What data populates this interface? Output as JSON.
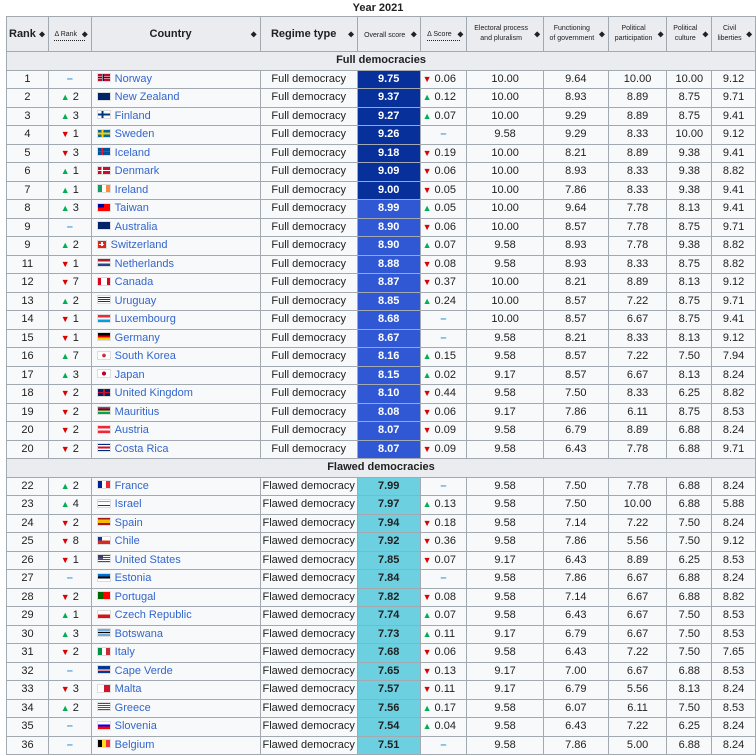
{
  "caption": "Year 2021",
  "headers": {
    "rank": "Rank",
    "delta_rank": "Δ Rank",
    "country": "Country",
    "regime_type": "Regime type",
    "overall_score": "Overall score",
    "delta_score": "Δ Score",
    "electoral": [
      "Electoral process",
      "and pluralism"
    ],
    "functioning": [
      "Functioning",
      "of government"
    ],
    "participation": [
      "Political",
      "participation"
    ],
    "culture": [
      "Political",
      "culture"
    ],
    "liberties": [
      "Civil",
      "liberties"
    ],
    "sort_icon": "⬥"
  },
  "colors": {
    "score_dark": "#08309a",
    "score_mid": "#3058d4",
    "score_flawed": "#6dd0e0",
    "up": "#00b050",
    "down": "#dd0000",
    "no_change": "#3b9cdd"
  },
  "sections": [
    {
      "title": "Full democracies",
      "rows": [
        {
          "rank": "1",
          "dr_dir": "none",
          "dr": "",
          "country": "Norway",
          "flag": "norway",
          "regime": "Full democracy",
          "score": "9.75",
          "tier": "dark",
          "ds_dir": "down",
          "ds": "0.06",
          "ep": "10.00",
          "fg": "9.64",
          "pp": "10.00",
          "pc": "10.00",
          "cl": "9.12"
        },
        {
          "rank": "2",
          "dr_dir": "up",
          "dr": "2",
          "country": "New Zealand",
          "flag": "nz",
          "regime": "Full democracy",
          "score": "9.37",
          "tier": "dark",
          "ds_dir": "up",
          "ds": "0.12",
          "ep": "10.00",
          "fg": "8.93",
          "pp": "8.89",
          "pc": "8.75",
          "cl": "9.71"
        },
        {
          "rank": "3",
          "dr_dir": "up",
          "dr": "3",
          "country": "Finland",
          "flag": "finland",
          "regime": "Full democracy",
          "score": "9.27",
          "tier": "dark",
          "ds_dir": "up",
          "ds": "0.07",
          "ep": "10.00",
          "fg": "9.29",
          "pp": "8.89",
          "pc": "8.75",
          "cl": "9.41"
        },
        {
          "rank": "4",
          "dr_dir": "down",
          "dr": "1",
          "country": "Sweden",
          "flag": "sweden",
          "regime": "Full democracy",
          "score": "9.26",
          "tier": "dark",
          "ds_dir": "none",
          "ds": "",
          "ep": "9.58",
          "fg": "9.29",
          "pp": "8.33",
          "pc": "10.00",
          "cl": "9.12"
        },
        {
          "rank": "5",
          "dr_dir": "down",
          "dr": "3",
          "country": "Iceland",
          "flag": "iceland",
          "regime": "Full democracy",
          "score": "9.18",
          "tier": "dark",
          "ds_dir": "down",
          "ds": "0.19",
          "ep": "10.00",
          "fg": "8.21",
          "pp": "8.89",
          "pc": "9.38",
          "cl": "9.41"
        },
        {
          "rank": "6",
          "dr_dir": "up",
          "dr": "1",
          "country": "Denmark",
          "flag": "denmark",
          "regime": "Full democracy",
          "score": "9.09",
          "tier": "dark",
          "ds_dir": "down",
          "ds": "0.06",
          "ep": "10.00",
          "fg": "8.93",
          "pp": "8.33",
          "pc": "9.38",
          "cl": "8.82"
        },
        {
          "rank": "7",
          "dr_dir": "up",
          "dr": "1",
          "country": "Ireland",
          "flag": "ireland",
          "regime": "Full democracy",
          "score": "9.00",
          "tier": "dark",
          "ds_dir": "down",
          "ds": "0.05",
          "ep": "10.00",
          "fg": "7.86",
          "pp": "8.33",
          "pc": "9.38",
          "cl": "9.41"
        },
        {
          "rank": "8",
          "dr_dir": "up",
          "dr": "3",
          "country": "Taiwan",
          "flag": "taiwan",
          "regime": "Full democracy",
          "score": "8.99",
          "tier": "mid",
          "ds_dir": "up",
          "ds": "0.05",
          "ep": "10.00",
          "fg": "9.64",
          "pp": "7.78",
          "pc": "8.13",
          "cl": "9.41"
        },
        {
          "rank": "9",
          "dr_dir": "none",
          "dr": "",
          "country": "Australia",
          "flag": "australia",
          "regime": "Full democracy",
          "score": "8.90",
          "tier": "mid",
          "ds_dir": "down",
          "ds": "0.06",
          "ep": "10.00",
          "fg": "8.57",
          "pp": "7.78",
          "pc": "8.75",
          "cl": "9.71"
        },
        {
          "rank": "9",
          "dr_dir": "up",
          "dr": "2",
          "country": "Switzerland",
          "flag": "switzerland",
          "regime": "Full democracy",
          "score": "8.90",
          "tier": "mid",
          "ds_dir": "up",
          "ds": "0.07",
          "ep": "9.58",
          "fg": "8.93",
          "pp": "7.78",
          "pc": "9.38",
          "cl": "8.82"
        },
        {
          "rank": "11",
          "dr_dir": "down",
          "dr": "1",
          "country": "Netherlands",
          "flag": "netherlands",
          "regime": "Full democracy",
          "score": "8.88",
          "tier": "mid",
          "ds_dir": "down",
          "ds": "0.08",
          "ep": "9.58",
          "fg": "8.93",
          "pp": "8.33",
          "pc": "8.75",
          "cl": "8.82"
        },
        {
          "rank": "12",
          "dr_dir": "down",
          "dr": "7",
          "country": "Canada",
          "flag": "canada",
          "regime": "Full democracy",
          "score": "8.87",
          "tier": "mid",
          "ds_dir": "down",
          "ds": "0.37",
          "ep": "10.00",
          "fg": "8.21",
          "pp": "8.89",
          "pc": "8.13",
          "cl": "9.12"
        },
        {
          "rank": "13",
          "dr_dir": "up",
          "dr": "2",
          "country": "Uruguay",
          "flag": "uruguay",
          "regime": "Full democracy",
          "score": "8.85",
          "tier": "mid",
          "ds_dir": "up",
          "ds": "0.24",
          "ep": "10.00",
          "fg": "8.57",
          "pp": "7.22",
          "pc": "8.75",
          "cl": "9.71"
        },
        {
          "rank": "14",
          "dr_dir": "down",
          "dr": "1",
          "country": "Luxembourg",
          "flag": "luxembourg",
          "regime": "Full democracy",
          "score": "8.68",
          "tier": "mid",
          "ds_dir": "none",
          "ds": "",
          "ep": "10.00",
          "fg": "8.57",
          "pp": "6.67",
          "pc": "8.75",
          "cl": "9.41"
        },
        {
          "rank": "15",
          "dr_dir": "down",
          "dr": "1",
          "country": "Germany",
          "flag": "germany",
          "regime": "Full democracy",
          "score": "8.67",
          "tier": "mid",
          "ds_dir": "none",
          "ds": "",
          "ep": "9.58",
          "fg": "8.21",
          "pp": "8.33",
          "pc": "8.13",
          "cl": "9.12"
        },
        {
          "rank": "16",
          "dr_dir": "up",
          "dr": "7",
          "country": "South Korea",
          "flag": "korea",
          "regime": "Full democracy",
          "score": "8.16",
          "tier": "mid",
          "ds_dir": "up",
          "ds": "0.15",
          "ep": "9.58",
          "fg": "8.57",
          "pp": "7.22",
          "pc": "7.50",
          "cl": "7.94"
        },
        {
          "rank": "17",
          "dr_dir": "up",
          "dr": "3",
          "country": "Japan",
          "flag": "japan",
          "regime": "Full democracy",
          "score": "8.15",
          "tier": "mid",
          "ds_dir": "up",
          "ds": "0.02",
          "ep": "9.17",
          "fg": "8.57",
          "pp": "6.67",
          "pc": "8.13",
          "cl": "8.24"
        },
        {
          "rank": "18",
          "dr_dir": "down",
          "dr": "2",
          "country": "United Kingdom",
          "flag": "uk",
          "regime": "Full democracy",
          "score": "8.10",
          "tier": "mid",
          "ds_dir": "down",
          "ds": "0.44",
          "ep": "9.58",
          "fg": "7.50",
          "pp": "8.33",
          "pc": "6.25",
          "cl": "8.82"
        },
        {
          "rank": "19",
          "dr_dir": "down",
          "dr": "2",
          "country": "Mauritius",
          "flag": "mauritius",
          "regime": "Full democracy",
          "score": "8.08",
          "tier": "mid",
          "ds_dir": "down",
          "ds": "0.06",
          "ep": "9.17",
          "fg": "7.86",
          "pp": "6.11",
          "pc": "8.75",
          "cl": "8.53"
        },
        {
          "rank": "20",
          "dr_dir": "down",
          "dr": "2",
          "country": "Austria",
          "flag": "austria",
          "regime": "Full democracy",
          "score": "8.07",
          "tier": "mid",
          "ds_dir": "down",
          "ds": "0.09",
          "ep": "9.58",
          "fg": "6.79",
          "pp": "8.89",
          "pc": "6.88",
          "cl": "8.24"
        },
        {
          "rank": "20",
          "dr_dir": "down",
          "dr": "2",
          "country": "Costa Rica",
          "flag": "costarica",
          "regime": "Full democracy",
          "score": "8.07",
          "tier": "mid",
          "ds_dir": "down",
          "ds": "0.09",
          "ep": "9.58",
          "fg": "6.43",
          "pp": "7.78",
          "pc": "6.88",
          "cl": "9.71"
        }
      ]
    },
    {
      "title": "Flawed democracies",
      "rows": [
        {
          "rank": "22",
          "dr_dir": "up",
          "dr": "2",
          "country": "France",
          "flag": "france",
          "regime": "Flawed democracy",
          "score": "7.99",
          "tier": "flawed",
          "ds_dir": "none",
          "ds": "",
          "ep": "9.58",
          "fg": "7.50",
          "pp": "7.78",
          "pc": "6.88",
          "cl": "8.24"
        },
        {
          "rank": "23",
          "dr_dir": "up",
          "dr": "4",
          "country": "Israel",
          "flag": "israel",
          "regime": "Flawed democracy",
          "score": "7.97",
          "tier": "flawed",
          "ds_dir": "up",
          "ds": "0.13",
          "ep": "9.58",
          "fg": "7.50",
          "pp": "10.00",
          "pc": "6.88",
          "cl": "5.88"
        },
        {
          "rank": "24",
          "dr_dir": "down",
          "dr": "2",
          "country": "Spain",
          "flag": "spain",
          "regime": "Flawed democracy",
          "score": "7.94",
          "tier": "flawed",
          "ds_dir": "down",
          "ds": "0.18",
          "ep": "9.58",
          "fg": "7.14",
          "pp": "7.22",
          "pc": "7.50",
          "cl": "8.24"
        },
        {
          "rank": "25",
          "dr_dir": "down",
          "dr": "8",
          "country": "Chile",
          "flag": "chile",
          "regime": "Flawed democracy",
          "score": "7.92",
          "tier": "flawed",
          "ds_dir": "down",
          "ds": "0.36",
          "ep": "9.58",
          "fg": "7.86",
          "pp": "5.56",
          "pc": "7.50",
          "cl": "9.12"
        },
        {
          "rank": "26",
          "dr_dir": "down",
          "dr": "1",
          "country": "United States",
          "flag": "usa",
          "regime": "Flawed democracy",
          "score": "7.85",
          "tier": "flawed",
          "ds_dir": "down",
          "ds": "0.07",
          "ep": "9.17",
          "fg": "6.43",
          "pp": "8.89",
          "pc": "6.25",
          "cl": "8.53"
        },
        {
          "rank": "27",
          "dr_dir": "none",
          "dr": "",
          "country": "Estonia",
          "flag": "estonia",
          "regime": "Flawed democracy",
          "score": "7.84",
          "tier": "flawed",
          "ds_dir": "none",
          "ds": "",
          "ep": "9.58",
          "fg": "7.86",
          "pp": "6.67",
          "pc": "6.88",
          "cl": "8.24"
        },
        {
          "rank": "28",
          "dr_dir": "down",
          "dr": "2",
          "country": "Portugal",
          "flag": "portugal",
          "regime": "Flawed democracy",
          "score": "7.82",
          "tier": "flawed",
          "ds_dir": "down",
          "ds": "0.08",
          "ep": "9.58",
          "fg": "7.14",
          "pp": "6.67",
          "pc": "6.88",
          "cl": "8.82"
        },
        {
          "rank": "29",
          "dr_dir": "up",
          "dr": "1",
          "country": "Czech Republic",
          "flag": "czech",
          "regime": "Flawed democracy",
          "score": "7.74",
          "tier": "flawed",
          "ds_dir": "up",
          "ds": "0.07",
          "ep": "9.58",
          "fg": "6.43",
          "pp": "6.67",
          "pc": "7.50",
          "cl": "8.53"
        },
        {
          "rank": "30",
          "dr_dir": "up",
          "dr": "3",
          "country": "Botswana",
          "flag": "botswana",
          "regime": "Flawed democracy",
          "score": "7.73",
          "tier": "flawed",
          "ds_dir": "up",
          "ds": "0.11",
          "ep": "9.17",
          "fg": "6.79",
          "pp": "6.67",
          "pc": "7.50",
          "cl": "8.53"
        },
        {
          "rank": "31",
          "dr_dir": "down",
          "dr": "2",
          "country": "Italy",
          "flag": "italy",
          "regime": "Flawed democracy",
          "score": "7.68",
          "tier": "flawed",
          "ds_dir": "down",
          "ds": "0.06",
          "ep": "9.58",
          "fg": "6.43",
          "pp": "7.22",
          "pc": "7.50",
          "cl": "7.65"
        },
        {
          "rank": "32",
          "dr_dir": "none",
          "dr": "",
          "country": "Cape Verde",
          "flag": "capeverde",
          "regime": "Flawed democracy",
          "score": "7.65",
          "tier": "flawed",
          "ds_dir": "down",
          "ds": "0.13",
          "ep": "9.17",
          "fg": "7.00",
          "pp": "6.67",
          "pc": "6.88",
          "cl": "8.53"
        },
        {
          "rank": "33",
          "dr_dir": "down",
          "dr": "3",
          "country": "Malta",
          "flag": "malta",
          "regime": "Flawed democracy",
          "score": "7.57",
          "tier": "flawed",
          "ds_dir": "down",
          "ds": "0.11",
          "ep": "9.17",
          "fg": "6.79",
          "pp": "5.56",
          "pc": "8.13",
          "cl": "8.24"
        },
        {
          "rank": "34",
          "dr_dir": "up",
          "dr": "2",
          "country": "Greece",
          "flag": "greece",
          "regime": "Flawed democracy",
          "score": "7.56",
          "tier": "flawed",
          "ds_dir": "up",
          "ds": "0.17",
          "ep": "9.58",
          "fg": "6.07",
          "pp": "6.11",
          "pc": "7.50",
          "cl": "8.53"
        },
        {
          "rank": "35",
          "dr_dir": "none",
          "dr": "",
          "country": "Slovenia",
          "flag": "slovenia",
          "regime": "Flawed democracy",
          "score": "7.54",
          "tier": "flawed",
          "ds_dir": "up",
          "ds": "0.04",
          "ep": "9.58",
          "fg": "6.43",
          "pp": "7.22",
          "pc": "6.25",
          "cl": "8.24"
        },
        {
          "rank": "36",
          "dr_dir": "none",
          "dr": "",
          "country": "Belgium",
          "flag": "belgium",
          "regime": "Flawed democracy",
          "score": "7.51",
          "tier": "flawed",
          "ds_dir": "none",
          "ds": "",
          "ep": "9.58",
          "fg": "7.86",
          "pp": "5.00",
          "pc": "6.88",
          "cl": "8.24"
        }
      ]
    }
  ]
}
